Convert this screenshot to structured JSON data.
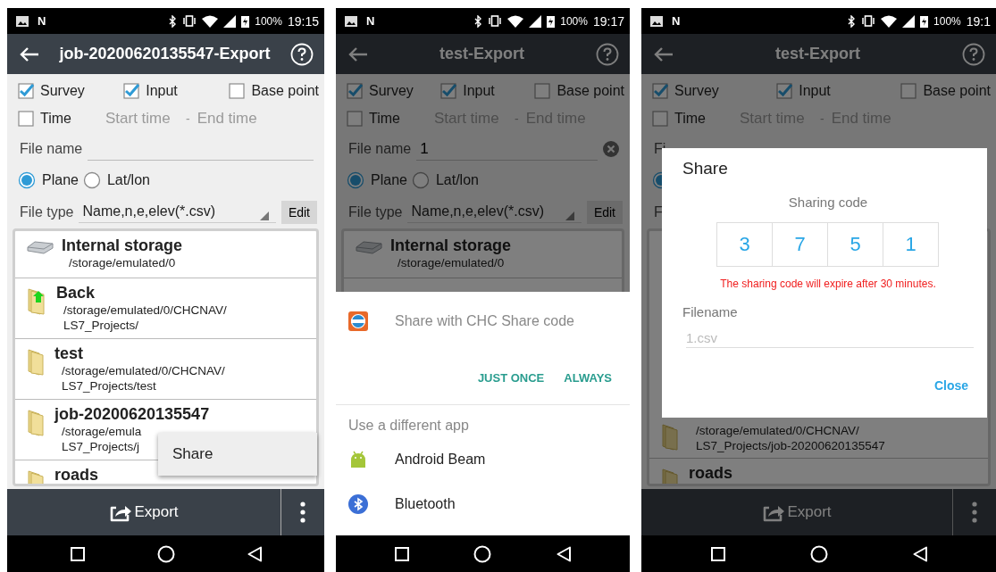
{
  "screens": [
    {
      "status_bar": {
        "logo": "N",
        "battery": "100%",
        "time": "19:15"
      },
      "header": {
        "title": "job-20200620135547-Export"
      },
      "dimmed": false,
      "checkboxes": [
        {
          "label": "Survey",
          "checked": true
        },
        {
          "label": "Input",
          "checked": true
        },
        {
          "label": "Base point",
          "checked": false
        }
      ],
      "time_filter": {
        "label": "Time",
        "checked": false,
        "start_placeholder": "Start time",
        "separator": "-",
        "end_placeholder": "End time"
      },
      "file_name": {
        "label": "File name"
      },
      "coordinates": [
        {
          "label": "Plane",
          "selected": true
        },
        {
          "label": "Lat/lon",
          "selected": false
        }
      ],
      "file_type": {
        "label": "File type",
        "value": "Name,n,e,elev(*.csv)",
        "button": "Edit"
      },
      "files": [
        {
          "kind": "storage",
          "name": "Internal storage",
          "path": [
            "/storage/emulated/0"
          ]
        },
        {
          "kind": "back",
          "name": "Back",
          "path": [
            "/storage/emulated/0/CHCNAV/",
            "LS7_Projects/"
          ]
        },
        {
          "kind": "folder",
          "name": "test",
          "path": [
            "/storage/emulated/0/CHCNAV/",
            "LS7_Projects/test"
          ]
        },
        {
          "kind": "folder",
          "name": "job-20200620135547",
          "path": [
            "/storage/emula",
            "LS7_Projects/j"
          ]
        },
        {
          "kind": "folder",
          "name": "roads"
        }
      ],
      "bottom_bar": {
        "action": "Export"
      },
      "overlay": {
        "kind": "menu",
        "items": [
          "Share"
        ]
      }
    },
    {
      "status_bar": {
        "logo": "N",
        "battery": "100%",
        "time": "19:17"
      },
      "header": {
        "title": "test-Export"
      },
      "dimmed": true,
      "checkboxes": [
        {
          "label": "Survey",
          "checked": true
        },
        {
          "label": "Input",
          "checked": true
        },
        {
          "label": "Base point",
          "checked": false
        }
      ],
      "time_filter": {
        "label": "Time",
        "checked": false,
        "start_placeholder": "Start time",
        "separator": "-",
        "end_placeholder": "End time"
      },
      "file_name": {
        "label": "File name",
        "value": "1"
      },
      "coordinates": [
        {
          "label": "Plane",
          "selected": true
        },
        {
          "label": "Lat/lon",
          "selected": false
        }
      ],
      "file_type": {
        "label": "File type",
        "value": "Name,n,e,elev(*.csv)",
        "button": "Edit"
      },
      "files": [
        {
          "kind": "storage",
          "name": "Internal storage",
          "path": [
            "/storage/emulated/0"
          ]
        }
      ],
      "overlay": {
        "kind": "sheet",
        "app": "Share with CHC Share code",
        "buttons": [
          "JUST ONCE",
          "ALWAYS"
        ],
        "section": "Use a different app",
        "apps": [
          {
            "kind": "android",
            "name": "Android Beam"
          },
          {
            "kind": "bluetooth",
            "name": "Bluetooth"
          }
        ]
      }
    },
    {
      "status_bar": {
        "logo": "N",
        "battery": "100%",
        "time": "19:1"
      },
      "header": {
        "title": "test-Export"
      },
      "dimmed": true,
      "checkboxes": [
        {
          "label": "Survey",
          "checked": true
        },
        {
          "label": "Input",
          "checked": true
        },
        {
          "label": "Base point",
          "checked": false
        }
      ],
      "time_filter": {
        "label": "Time",
        "checked": false,
        "start_placeholder": "Start time",
        "separator": "-",
        "end_placeholder": "End time"
      },
      "file_name": {
        "label": "Fi"
      },
      "coordinates": [
        {
          "selected": true
        }
      ],
      "file_type": {
        "label": "F"
      },
      "files": [
        {
          "kind": "folder",
          "path": [
            "/storage/emulated/0/CHCNAV/",
            "LS7_Projects/job-20200620135547"
          ]
        },
        {
          "kind": "folder",
          "name": "roads"
        }
      ],
      "bottom_bar": {
        "action": "Export"
      },
      "overlay": {
        "kind": "dialog",
        "title": "Share",
        "code_label": "Sharing code",
        "code": [
          "3",
          "7",
          "5",
          "1"
        ],
        "warning": "The sharing code will expire after 30 minutes.",
        "field_label": "Filename",
        "field_placeholder": "1.csv",
        "button": "Close"
      }
    }
  ]
}
